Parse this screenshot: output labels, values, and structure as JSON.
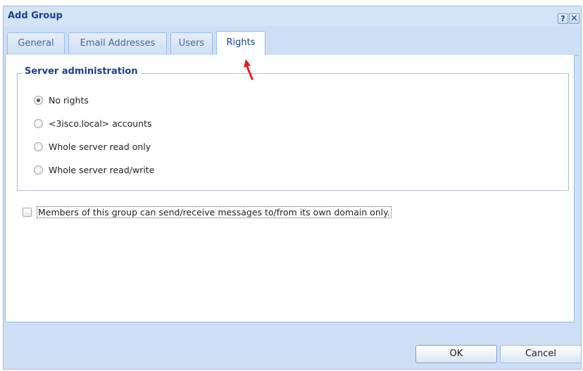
{
  "dialog": {
    "title": "Add Group",
    "help_glyph": "?",
    "close_glyph": "✕"
  },
  "tabs": [
    {
      "label": "General",
      "active": false
    },
    {
      "label": "Email Addresses",
      "active": false
    },
    {
      "label": "Users",
      "active": false
    },
    {
      "label": "Rights",
      "active": true
    }
  ],
  "server_admin": {
    "legend": "Server administration",
    "options": [
      {
        "label": "No rights",
        "selected": true
      },
      {
        "label": "<3isco.local> accounts",
        "selected": false
      },
      {
        "label": "Whole server read only",
        "selected": false
      },
      {
        "label": "Whole server read/write",
        "selected": false
      }
    ]
  },
  "domain_restriction": {
    "label": "Members of this group can send/receive messages to/from its own domain only.",
    "checked": false
  },
  "buttons": {
    "ok": "OK",
    "cancel": "Cancel"
  },
  "annotation": {
    "arrow_color": "#e02020",
    "icon": "red-arrow-icon"
  }
}
